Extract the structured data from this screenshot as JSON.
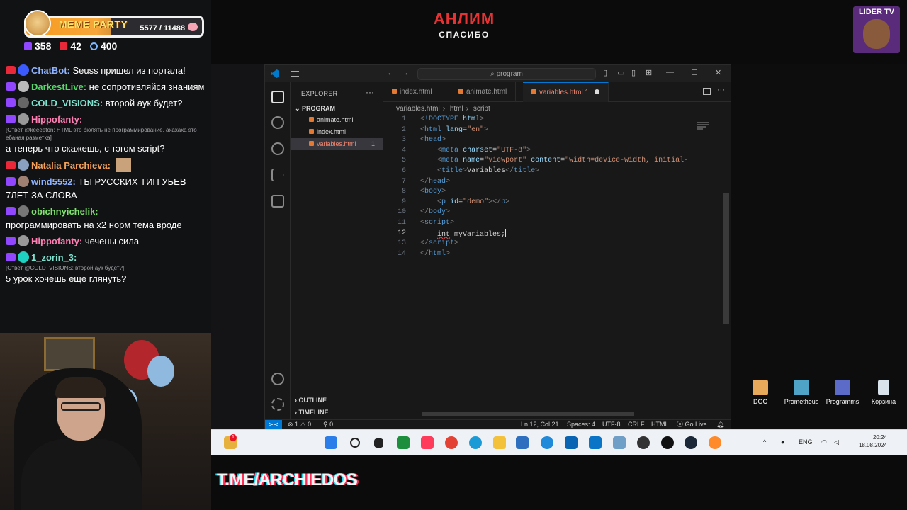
{
  "meme_party": {
    "title": "MEME PARTY",
    "count": "5577 / 11488"
  },
  "stats": {
    "viewers_a": "358",
    "viewers_b": "42",
    "viewers_c": "400"
  },
  "chat": [
    {
      "user": "ChatBot:",
      "text": " Seuss пришел из портала!",
      "color": "#8fb3ff"
    },
    {
      "user": "DarkestLive:",
      "text": " не сопротивляйся знаниям",
      "color": "#58d66b"
    },
    {
      "user": "COLD_VISIONS:",
      "text": " второй аук будет?",
      "color": "#7fe3d0"
    },
    {
      "user": "Hippofanty:",
      "text": "",
      "color": "#ff7eb3"
    },
    {
      "reply": "[Ответ @keeeeton: HTML это бюлять не программирование, ахахаха это ебаная разметка]",
      "text": "а теперь что скажешь, с тэгом script?"
    },
    {
      "user": "Natalia Parchieva:",
      "text": "",
      "color": "#f5a15a"
    },
    {
      "user": "wind5552:",
      "text": " ТЫ РУССКИХ ТИП УБЕВ 7ЛЕТ ЗА СЛОВА",
      "color": "#8fb3ff"
    },
    {
      "user": "obichnyichelik:",
      "text": "",
      "color": "#7de36b"
    },
    {
      "text": "программировать на x2 норм тема вроде"
    },
    {
      "user": "Hippofanty:",
      "text": " чечены сила",
      "color": "#ff7eb3"
    },
    {
      "user": "1_zorin_3:",
      "text": "",
      "color": "#7fe3d0"
    },
    {
      "reply": "[Ответ @COLD_VISIONS: второй аук будет?]",
      "text": "5 урок хочешь еще глянуть?"
    }
  ],
  "top": {
    "title": "АНЛИМ",
    "subtitle": "СПАСИБО"
  },
  "lider": "LIDER TV",
  "vscode": {
    "search": "program",
    "explorer_label": "EXPLORER",
    "folder": "PROGRAM",
    "files": [
      "animate.html",
      "index.html",
      "variables.html"
    ],
    "error_count": "1",
    "tabs": [
      "index.html",
      "animate.html",
      "variables.html 1"
    ],
    "breadcrumb": [
      "variables.html",
      "html",
      "script"
    ],
    "outline": "OUTLINE",
    "timeline": "TIMELINE",
    "status": {
      "errors": "⊗ 1 ⚠ 0",
      "ports": "⚲ 0",
      "position": "Ln 12, Col 21",
      "spaces": "Spaces: 4",
      "encoding": "UTF-8",
      "eol": "CRLF",
      "lang": "HTML",
      "golive": "⦿ Go Live"
    }
  },
  "desktop_icons": [
    "DOC",
    "Prometheus",
    "Programms",
    "Корзина"
  ],
  "taskbar": {
    "lang": "ENG",
    "time": "20:24",
    "date": "18.08.2024"
  },
  "bottom_text": "T.ME/ARCHIEDOS"
}
